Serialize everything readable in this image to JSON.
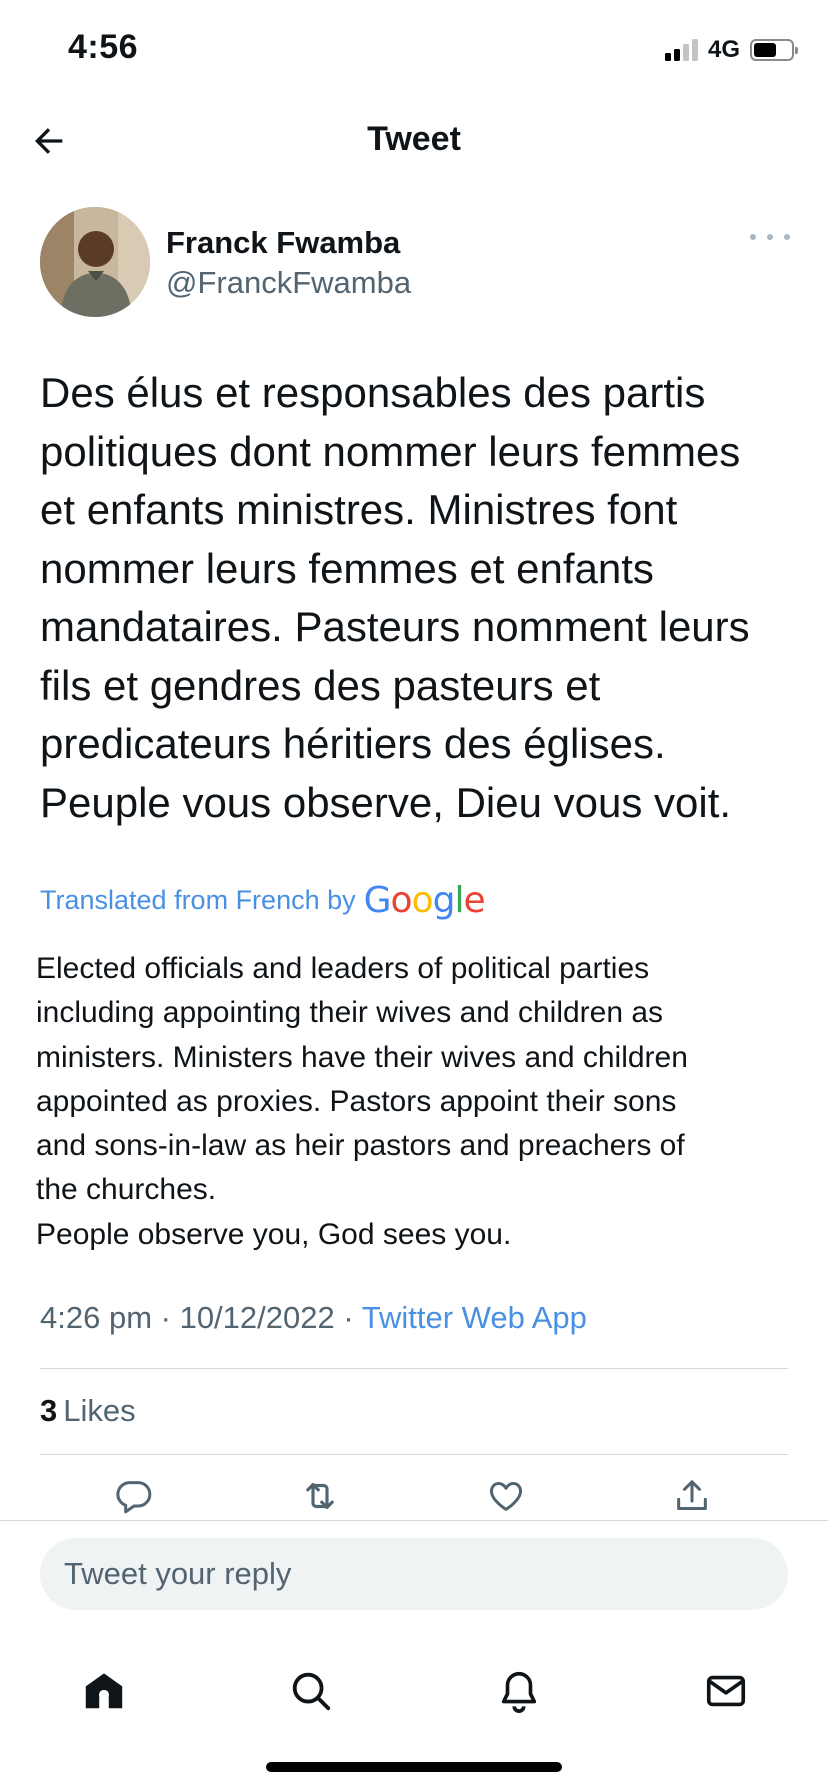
{
  "status_bar": {
    "time": "4:56",
    "network": "4G"
  },
  "header": {
    "title": "Tweet"
  },
  "author": {
    "name": "Franck Fwamba",
    "handle": "@FranckFwamba"
  },
  "tweet": {
    "text_lines": [
      "Des élus et responsables des partis",
      "politiques dont nommer leurs femmes",
      "et enfants ministres. Ministres font",
      "nommer leurs femmes et enfants",
      "mandataires. Pasteurs nomment leurs",
      "fils et gendres des pasteurs et",
      "predicateurs héritiers des églises.",
      "Peuple vous observe, Dieu vous voit."
    ],
    "translated_label": "Translated from French by",
    "translator": "Google",
    "translation_lines": [
      "Elected officials and leaders of political parties",
      "including appointing their wives and children as",
      "ministers. Ministers have their wives and children",
      "appointed as proxies. Pastors appoint their sons",
      "and sons-in-law as heir pastors and preachers of",
      "the churches.",
      "People observe you, God sees you."
    ],
    "time": "4:26 pm",
    "separator": "·",
    "date": "10/12/2022",
    "source": "Twitter Web App",
    "likes_count": "3",
    "likes_label": "Likes"
  },
  "reply": {
    "placeholder": "Tweet your reply"
  },
  "colors": {
    "link_blue": "#4a90e2",
    "secondary_text": "#536471",
    "divider": "#cfd9de",
    "input_bg": "#eff3f4"
  },
  "icons": {
    "back": "arrow-left-icon",
    "more": "more-horizontal-icon",
    "reply": "reply-icon",
    "retweet": "retweet-icon",
    "like": "heart-icon",
    "share": "share-icon",
    "home": "home-icon",
    "search": "search-icon",
    "notifications": "bell-icon",
    "messages": "mail-icon"
  }
}
